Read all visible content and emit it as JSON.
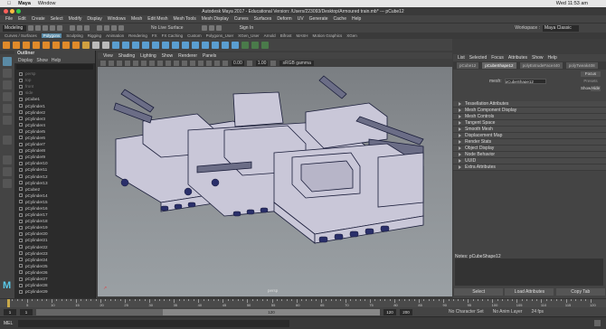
{
  "mac": {
    "app": "Maya",
    "window_menu": "Window",
    "time": "Wed 11:53 am"
  },
  "window": {
    "title": "Autodesk Maya 2017 - Educational Version: /Users/223093/Desktop/Armoured train.mb* --- pCube12"
  },
  "menubar": [
    "File",
    "Edit",
    "Create",
    "Select",
    "Modify",
    "Display",
    "Windows",
    "Mesh",
    "Edit Mesh",
    "Mesh Tools",
    "Mesh Display",
    "Curves",
    "Surfaces",
    "Deform",
    "UV",
    "Generate",
    "Cache",
    "Help"
  ],
  "status": {
    "mode": "Modeling",
    "live_surface": "No Live Surface",
    "sign_in": "Sign In",
    "workspace_label": "Workspace :",
    "workspace": "Maya Classic"
  },
  "shelf_tabs": [
    "Curves / Surfaces",
    "Polygons",
    "Sculpting",
    "Rigging",
    "Animation",
    "Rendering",
    "FX",
    "FX Caching",
    "Custom",
    "Polygons_User",
    "XGen_User",
    "Arnold",
    "Bifrost",
    "MASH",
    "Motion Graphics",
    "XGen"
  ],
  "outliner": {
    "title": "Outliner",
    "menu": [
      "Display",
      "Show",
      "Help"
    ],
    "items": [
      "persp",
      "top",
      "front",
      "side",
      "pCube1",
      "pCylinder1",
      "pCylinder2",
      "pCylinder3",
      "pCylinder4",
      "pCylinder5",
      "pCylinder6",
      "pCylinder7",
      "pCylinder8",
      "pCylinder9",
      "pCylinder10",
      "pCylinder11",
      "pCylinder12",
      "pCylinder13",
      "pCube2",
      "pCylinder14",
      "pCylinder15",
      "pCylinder16",
      "pCylinder17",
      "pCylinder18",
      "pCylinder19",
      "pCylinder20",
      "pCylinder21",
      "pCylinder22",
      "pCylinder23",
      "pCylinder24",
      "pCylinder25",
      "pCylinder26",
      "pCylinder27",
      "pCylinder28",
      "pCylinder29"
    ]
  },
  "viewport": {
    "menu": [
      "View",
      "Shading",
      "Lighting",
      "Show",
      "Renderer",
      "Panels"
    ],
    "near": "0.00",
    "far": "1.00",
    "color_space": "sRGB gamma",
    "camera": "persp"
  },
  "attribute_editor": {
    "tabs": [
      "List",
      "Selected",
      "Focus",
      "Attributes",
      "Show",
      "Help"
    ],
    "node_tabs": [
      "pCube12",
      "pCubeShape12",
      "polyExtrudeFace440",
      "polyTweak408"
    ],
    "mesh_label": "mesh:",
    "mesh_value": "pCubeShape12",
    "focus": "Focus",
    "presets": "Presets",
    "show": "Show",
    "hide": "Hide",
    "sections": [
      "Tessellation Attributes",
      "Mesh Component Display",
      "Mesh Controls",
      "Tangent Space",
      "Smooth Mesh",
      "Displacement Map",
      "Render Stats",
      "Object Display",
      "Node Behavior",
      "UUID",
      "Extra Attributes"
    ],
    "notes_label": "Notes: pCubeShape12",
    "buttons": [
      "Select",
      "Load Attributes",
      "Copy Tab"
    ]
  },
  "timeline": {
    "ticks": [
      "5",
      "10",
      "15",
      "20",
      "25",
      "30",
      "35",
      "40",
      "45",
      "50",
      "55",
      "60",
      "65",
      "70",
      "75",
      "80",
      "85",
      "90",
      "95",
      "100",
      "105",
      "110",
      "115",
      "120"
    ],
    "current": "1",
    "start": "1",
    "range_start": "1",
    "range_end": "120",
    "end": "120",
    "total": "200",
    "char_set": "No Character Set",
    "anim_layer": "No Anim Layer",
    "fps": "24 fps"
  },
  "command": {
    "label": "MEL"
  },
  "colors": {
    "accent": "#5a8aa5",
    "panel": "#444444",
    "viewport_top": "#7a7e82",
    "mesh_fill": "#c9c7d8",
    "wire": "#1a1d3a"
  }
}
